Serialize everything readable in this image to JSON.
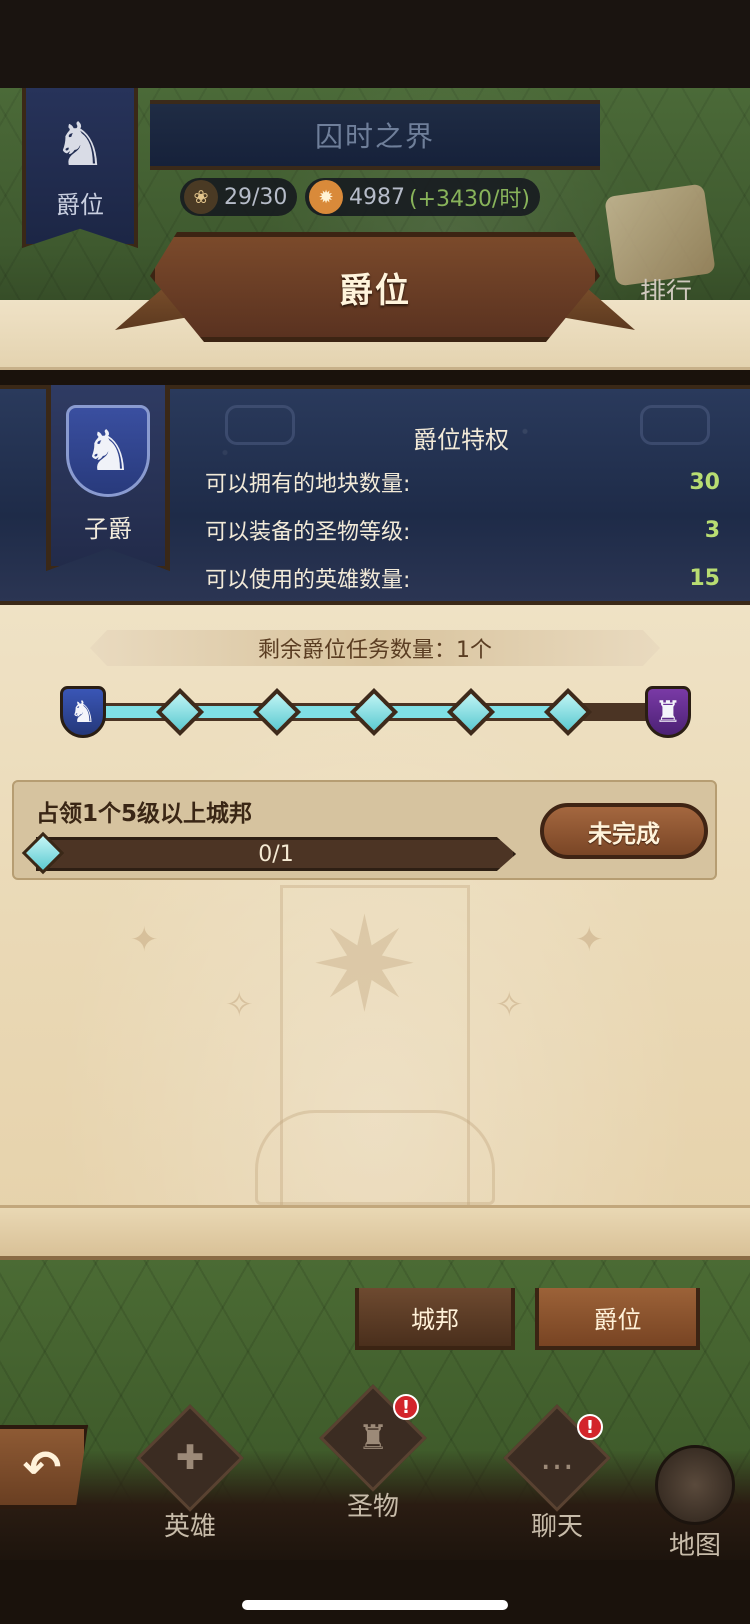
{
  "header": {
    "area_title": "囚时之界",
    "top_rank_label": "爵位",
    "resource_land": "29/30",
    "resource_fire": "4987",
    "resource_fire_rate": "(+3430/时)",
    "ghost_right_label": "排行"
  },
  "panel": {
    "title": "爵位"
  },
  "privilege": {
    "current_rank": "子爵",
    "section_title": "爵位特权",
    "rows": [
      {
        "label": "可以拥有的地块数量:",
        "value": "30"
      },
      {
        "label": "可以装备的圣物等级:",
        "value": "3"
      },
      {
        "label": "可以使用的英雄数量:",
        "value": "15"
      }
    ]
  },
  "progress": {
    "remaining_text": "剩余爵位任务数量：1个",
    "total_nodes": 5,
    "completed_nodes": 5
  },
  "task": {
    "title": "占领1个5级以上城邦",
    "progress_text": "0/1",
    "progress_fraction": 0,
    "status_label": "未完成"
  },
  "tabs": {
    "cities": "城邦",
    "rank": "爵位"
  },
  "bottom_nav": {
    "heroes": "英雄",
    "relics": "圣物",
    "chat": "聊天",
    "map": "地图",
    "badge_mark": "!"
  },
  "colors": {
    "accent_cyan": "#7fe0e6",
    "value_green": "#b8dd72",
    "wood_brown": "#7a4626",
    "parchment": "#ead9b6",
    "navy": "#1e2b48"
  }
}
